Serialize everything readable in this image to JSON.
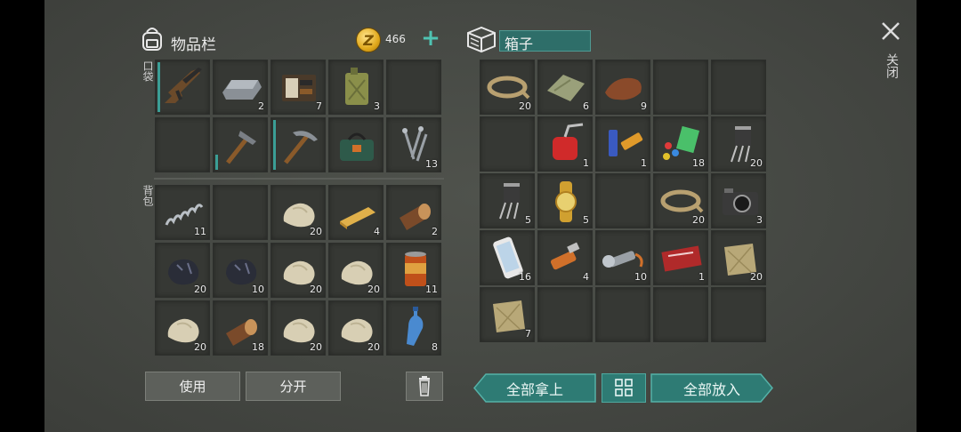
{
  "inventory": {
    "title": "物品栏",
    "coins": "466",
    "pocket_label": "口袋",
    "backpack_label": "背包",
    "pocket": [
      {
        "icon": "rifle-icon",
        "qty": "",
        "durability": 1.0
      },
      {
        "icon": "metal-ingot-icon",
        "qty": "2"
      },
      {
        "icon": "wallet-icon",
        "qty": "7"
      },
      {
        "icon": "jerrycan-icon",
        "qty": "3"
      },
      {
        "icon": "",
        "qty": ""
      },
      {
        "icon": "",
        "qty": ""
      },
      {
        "icon": "hammer-icon",
        "qty": "",
        "durability": 0.3
      },
      {
        "icon": "pickaxe-icon",
        "qty": "",
        "durability": 1.0
      },
      {
        "icon": "toolbag-icon",
        "qty": ""
      },
      {
        "icon": "nails-icon",
        "qty": "13"
      }
    ],
    "backpack": [
      {
        "icon": "spring-icon",
        "qty": "11"
      },
      {
        "icon": "",
        "qty": ""
      },
      {
        "icon": "stone-icon",
        "qty": "20"
      },
      {
        "icon": "wood-plank-icon",
        "qty": "4"
      },
      {
        "icon": "log-icon",
        "qty": "2"
      },
      {
        "icon": "coal-icon",
        "qty": "20"
      },
      {
        "icon": "coal-icon",
        "qty": "10"
      },
      {
        "icon": "stone-icon",
        "qty": "20"
      },
      {
        "icon": "stone-icon",
        "qty": "20"
      },
      {
        "icon": "canned-food-icon",
        "qty": "11"
      },
      {
        "icon": "stone-icon",
        "qty": "20"
      },
      {
        "icon": "log-icon",
        "qty": "18"
      },
      {
        "icon": "stone-icon",
        "qty": "20"
      },
      {
        "icon": "stone-icon",
        "qty": "20"
      },
      {
        "icon": "water-bottle-icon",
        "qty": "8"
      }
    ],
    "use_label": "使用",
    "split_label": "分开"
  },
  "box": {
    "title": "箱子",
    "items": [
      {
        "icon": "rope-icon",
        "qty": "20"
      },
      {
        "icon": "cloth-icon",
        "qty": "6"
      },
      {
        "icon": "leather-icon",
        "qty": "9"
      },
      {
        "icon": "",
        "qty": ""
      },
      {
        "icon": "",
        "qty": ""
      },
      {
        "icon": "",
        "qty": ""
      },
      {
        "icon": "oil-can-icon",
        "qty": "1"
      },
      {
        "icon": "batteries-icon",
        "qty": "1"
      },
      {
        "icon": "chips-icon",
        "qty": "18"
      },
      {
        "icon": "transistor-icon",
        "qty": "20"
      },
      {
        "icon": "transistor-icon",
        "qty": "5"
      },
      {
        "icon": "watch-icon",
        "qty": "5"
      },
      {
        "icon": "",
        "qty": ""
      },
      {
        "icon": "rope-icon",
        "qty": "20"
      },
      {
        "icon": "camera-icon",
        "qty": "3"
      },
      {
        "icon": "smartphone-icon",
        "qty": "16"
      },
      {
        "icon": "usb-drive-icon",
        "qty": "4"
      },
      {
        "icon": "flashlight-icon",
        "qty": "10"
      },
      {
        "icon": "coupon-icon",
        "qty": "1"
      },
      {
        "icon": "burlap-icon",
        "qty": "20"
      },
      {
        "icon": "burlap-icon",
        "qty": "7"
      },
      {
        "icon": "",
        "qty": ""
      },
      {
        "icon": "",
        "qty": ""
      },
      {
        "icon": "",
        "qty": ""
      },
      {
        "icon": "",
        "qty": ""
      }
    ],
    "take_all_label": "全部拿上",
    "put_all_label": "全部放入"
  },
  "close_label": "关闭",
  "colors": {
    "accent": "#2e7b74",
    "accent_light": "#4fc3b2",
    "coin": "#e0a91c"
  }
}
